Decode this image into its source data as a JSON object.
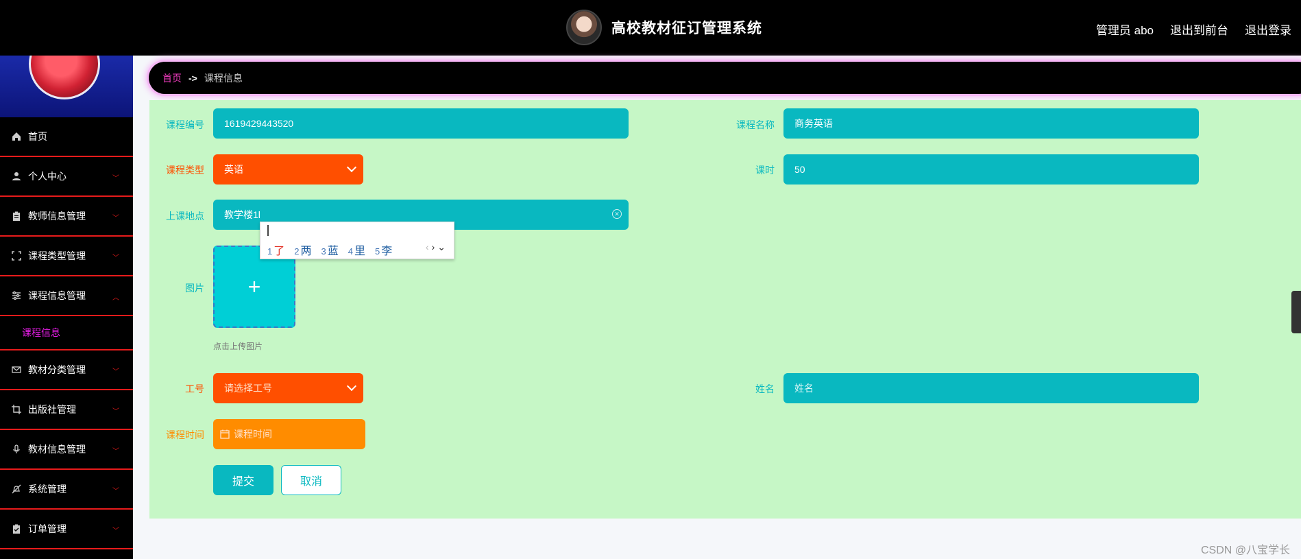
{
  "header": {
    "title": "高校教材征订管理系统",
    "user_label": "管理员 abo",
    "front_label": "退出到前台",
    "logout_label": "退出登录"
  },
  "sidebar": {
    "items": [
      {
        "label": "首页",
        "icon": "home-icon"
      },
      {
        "label": "个人中心",
        "icon": "user-icon"
      },
      {
        "label": "教师信息管理",
        "icon": "clipboard-icon"
      },
      {
        "label": "课程类型管理",
        "icon": "frame-icon"
      },
      {
        "label": "课程信息管理",
        "icon": "sliders-icon"
      },
      {
        "label": "教材分类管理",
        "icon": "mail-icon"
      },
      {
        "label": "出版社管理",
        "icon": "crop-icon"
      },
      {
        "label": "教材信息管理",
        "icon": "mic-icon"
      },
      {
        "label": "系统管理",
        "icon": "bell-off-icon"
      },
      {
        "label": "订单管理",
        "icon": "clipboard-check-icon"
      }
    ],
    "active_sub": "课程信息"
  },
  "breadcrumb": {
    "home": "首页",
    "sep": "->",
    "current": "课程信息"
  },
  "form": {
    "course_no": {
      "label": "课程编号",
      "value": "1619429443520"
    },
    "course_name": {
      "label": "课程名称",
      "value": "商务英语"
    },
    "course_type": {
      "label": "课程类型",
      "value": "英语"
    },
    "hours": {
      "label": "课时",
      "value": "50"
    },
    "location": {
      "label": "上课地点",
      "value": "教学楼1l"
    },
    "image": {
      "label": "图片",
      "tip": "点击上传图片"
    },
    "job_no": {
      "label": "工号",
      "placeholder": "请选择工号"
    },
    "name": {
      "label": "姓名",
      "placeholder": "姓名"
    },
    "course_time": {
      "label": "课程时间",
      "placeholder": "课程时间"
    },
    "submit_label": "提交",
    "cancel_label": "取消"
  },
  "ime": {
    "candidates": [
      {
        "n": "1",
        "c": "了"
      },
      {
        "n": "2",
        "c": "两"
      },
      {
        "n": "3",
        "c": "蓝"
      },
      {
        "n": "4",
        "c": "里"
      },
      {
        "n": "5",
        "c": "李"
      }
    ]
  },
  "watermark": "CSDN @八宝学长",
  "colors": {
    "accent_teal": "#09b8c0",
    "select_orange": "#ff4f00",
    "date_orange": "#ff8c00",
    "panel_green": "#c6f7c6"
  }
}
